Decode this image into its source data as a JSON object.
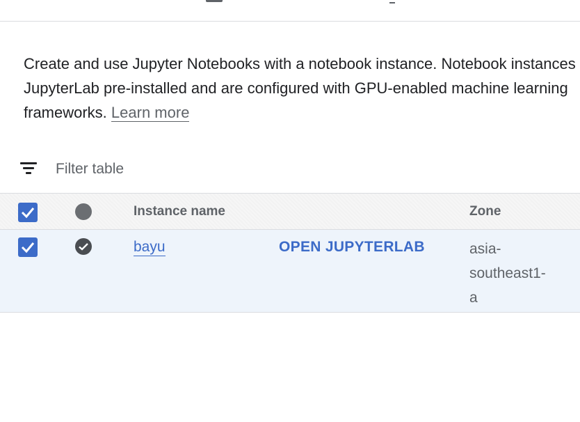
{
  "description": {
    "line1": "Create and use Jupyter Notebooks with a notebook instance. Notebook instances",
    "line2": "JupyterLab pre-installed and are configured with GPU-enabled machine learning",
    "line3_prefix": "frameworks.",
    "learn_more": "Learn more"
  },
  "filter": {
    "icon": "filter-list-icon",
    "placeholder": "Filter table"
  },
  "table": {
    "columns": {
      "instance_name": "Instance name",
      "zone": "Zone"
    },
    "rows": [
      {
        "selected": true,
        "status_icon": "check-circle-icon",
        "name": "bayu",
        "action": "OPEN JUPYTERLAB",
        "zone_lines": [
          "asia-",
          "southeast1-",
          "a"
        ]
      }
    ]
  },
  "colors": {
    "accent": "#3c6bc8",
    "row_selected_bg": "#eef4fb",
    "muted_text": "#5f6368"
  }
}
